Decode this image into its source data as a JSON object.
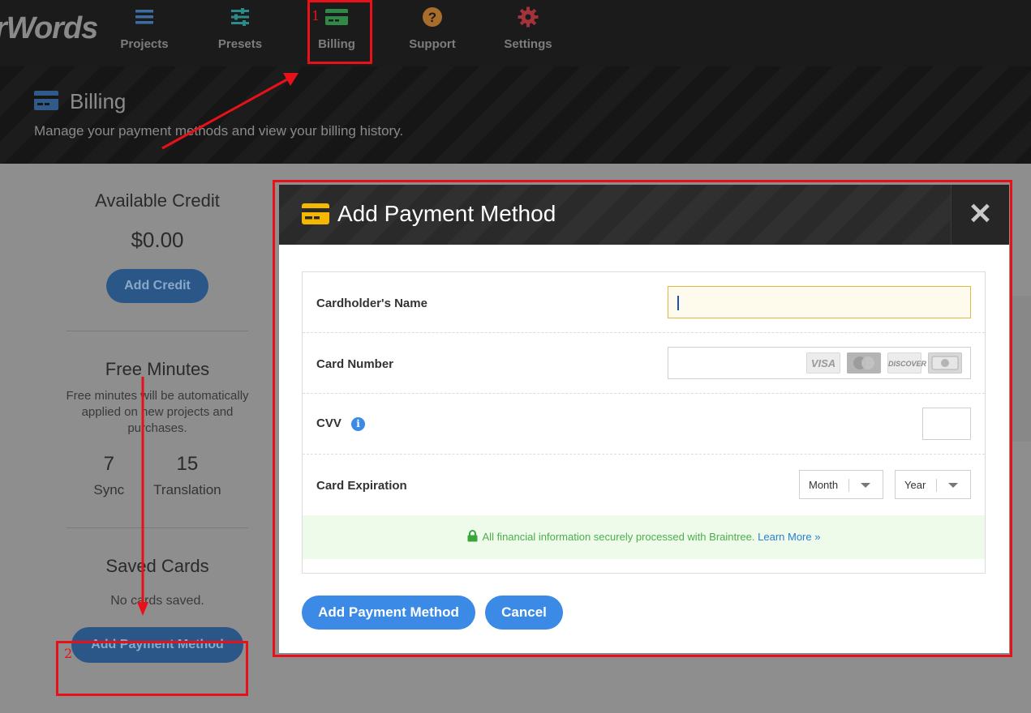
{
  "app": {
    "logo_text": "rWords"
  },
  "nav": {
    "items": [
      {
        "label": "Projects",
        "icon": "list-icon",
        "color": "#3d6ea3"
      },
      {
        "label": "Presets",
        "icon": "sliders-icon",
        "color": "#2b8a8a"
      },
      {
        "label": "Billing",
        "icon": "credit-card-icon",
        "color": "#2f8a48"
      },
      {
        "label": "Support",
        "icon": "question-circle-icon",
        "color": "#a86d2b"
      },
      {
        "label": "Settings",
        "icon": "gear-icon",
        "color": "#a3333a"
      }
    ]
  },
  "page_header": {
    "title": "Billing",
    "subtitle": "Manage your payment methods and view your billing history."
  },
  "sidebar": {
    "credit": {
      "title": "Available Credit",
      "value": "$0.00",
      "button": "Add Credit"
    },
    "free_minutes": {
      "title": "Free Minutes",
      "description": "Free minutes will be automatically applied on new projects and purchases.",
      "stats": [
        {
          "value": "7",
          "label": "Sync"
        },
        {
          "value": "15",
          "label": "Translation"
        }
      ]
    },
    "saved_cards": {
      "title": "Saved Cards",
      "empty_text": "No cards saved.",
      "button": "Add Payment Method"
    }
  },
  "modal": {
    "title": "Add Payment Method",
    "close_glyph": "✕",
    "fields": {
      "name_label": "Cardholder's Name",
      "name_value": "",
      "number_label": "Card Number",
      "number_value": "",
      "card_brands": [
        "VISA",
        "MasterCard",
        "DISCOVER",
        "AMEX"
      ],
      "cvv_label": "CVV",
      "cvv_value": "",
      "expiration_label": "Card Expiration",
      "month_selected": "Month",
      "year_selected": "Year"
    },
    "secure_text": "All financial information securely processed with Braintree.",
    "learn_more": "Learn More »",
    "primary_button": "Add Payment Method",
    "cancel_button": "Cancel"
  },
  "annotations": {
    "step1": "1",
    "step2": "2",
    "color": "#e8111a"
  },
  "colors": {
    "accent_blue": "#3b8ae6",
    "dim_button": "#2a5787",
    "card_yellow": "#f5b800"
  }
}
